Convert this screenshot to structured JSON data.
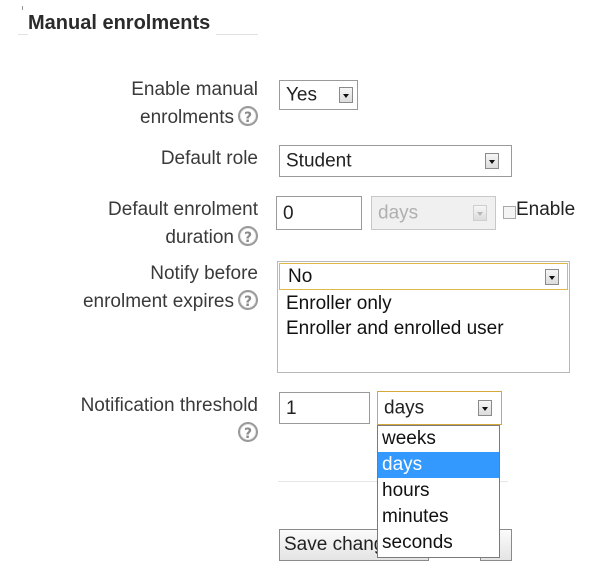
{
  "section": {
    "title": "Manual enrolments"
  },
  "fields": {
    "enable_manual": {
      "label_line1": "Enable manual",
      "label_line2": "enrolments",
      "value": "Yes"
    },
    "default_role": {
      "label": "Default role",
      "value": "Student"
    },
    "default_duration": {
      "label_line1": "Default enrolment",
      "label_line2": "duration",
      "number": "0",
      "unit": "days",
      "enable_label": "Enable"
    },
    "notify_before": {
      "label_line1": "Notify before",
      "label_line2": "enrolment expires",
      "options": [
        "No",
        "Enroller only",
        "Enroller and enrolled user"
      ]
    },
    "notification_threshold": {
      "label": "Notification threshold",
      "number": "1",
      "unit": "days",
      "dropdown_options": [
        "weeks",
        "days",
        "hours",
        "minutes",
        "seconds"
      ],
      "selected_option": "days"
    }
  },
  "buttons": {
    "save": "Save changes"
  },
  "icons": {
    "help": "?"
  }
}
